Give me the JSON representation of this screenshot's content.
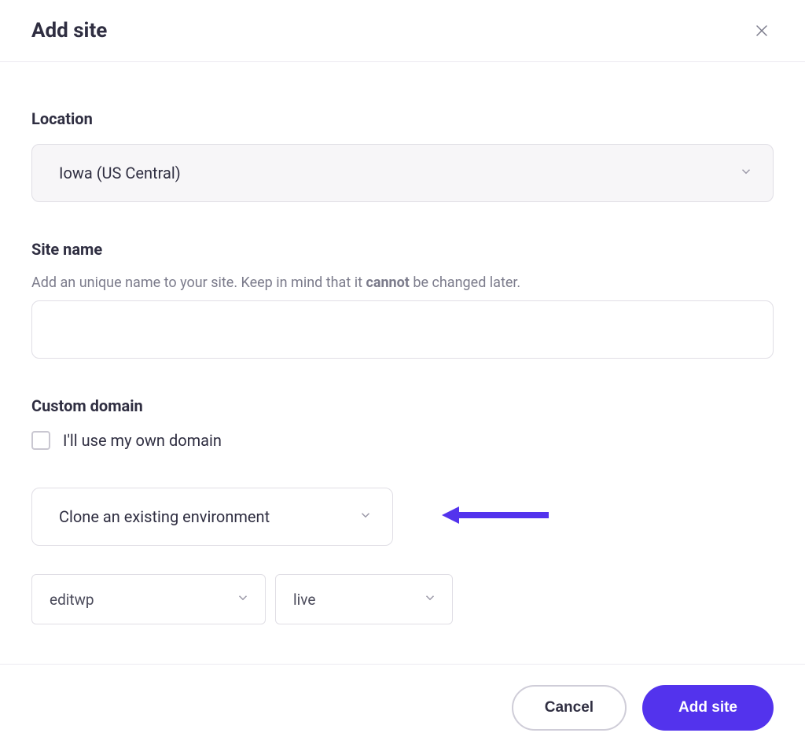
{
  "header": {
    "title": "Add site"
  },
  "location": {
    "label": "Location",
    "value": "Iowa (US Central)"
  },
  "siteName": {
    "label": "Site name",
    "help_pre": "Add an unique name to your site. Keep in mind that it ",
    "help_bold": "cannot",
    "help_post": " be changed later.",
    "value": ""
  },
  "customDomain": {
    "label": "Custom domain",
    "checkbox_label": "I'll use my own domain"
  },
  "environment": {
    "mode": "Clone an existing environment",
    "site": "editwp",
    "env": "live"
  },
  "footer": {
    "cancel": "Cancel",
    "submit": "Add site"
  },
  "colors": {
    "accent": "#5333ed"
  }
}
